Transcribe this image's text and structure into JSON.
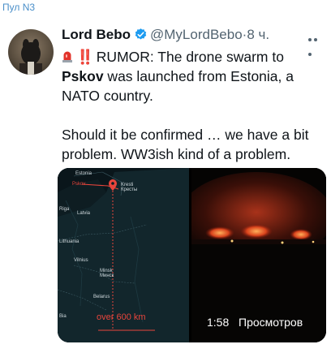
{
  "channel": {
    "tag": "Пул N3"
  },
  "tweet": {
    "author_name": "Lord Bebo",
    "handle": "@MyLordBebo",
    "separator": "·",
    "time": "8 ч.",
    "text_line1_prefix": "RUMOR: The drone swarm to",
    "text_bold_city": "Pskov",
    "text_line2_rest": " was launched from Estonia, a NATO country.",
    "text_para2": "Should it be confirmed … we have a bit problem. WW3ish kind of a problem.",
    "exclamation": "‼️"
  },
  "media": {
    "map": {
      "labels": {
        "estonia": "Estonia",
        "latvia": "Latvia",
        "riga": "Riga",
        "vilnius": "Vilnius",
        "minsk": "Minsk\nМинск",
        "belarus": "Belarus",
        "pskov": "Pskov",
        "kresti": "Kresti\nКресты",
        "lithuania": "Lithuania",
        "bia": "Bia"
      },
      "distance_label": "over 600 km",
      "colors": {
        "route": "#e8453c",
        "land": "#12262c",
        "sea": "#0a161b"
      }
    },
    "video": {
      "duration": "1:58",
      "views_label": "Просмотров",
      "colors": {
        "fire": "#c23a1a",
        "sky": "#1a0806"
      }
    }
  },
  "icons": {
    "verified": "verified-badge-icon",
    "more": "more-dots-icon",
    "siren": "police-light-icon",
    "pin": "map-pin-icon"
  }
}
